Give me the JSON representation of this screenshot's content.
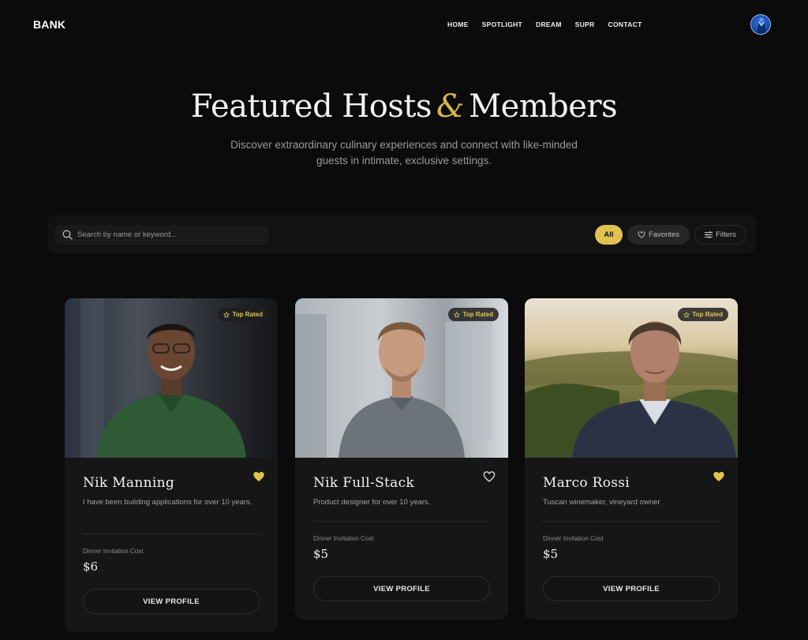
{
  "nav": {
    "logo_mark": "",
    "logo": "BANK",
    "items": [
      "HOME",
      "SPOTLIGHT",
      "DREAM",
      "SUPR",
      "CONTACT"
    ],
    "avatar_icon": "user-avatar"
  },
  "hero": {
    "title_part1": "Featured Hosts",
    "ampersand": "&",
    "title_part2": "Members",
    "subtitle": "Discover extraordinary culinary experiences and connect with like-minded guests in intimate, exclusive settings."
  },
  "toolbar": {
    "search_placeholder": "Search by name or keyword...",
    "search_value": "",
    "filters": {
      "all": "All",
      "favorites": "Favorites",
      "filters": "Filters"
    },
    "active_filter": "All"
  },
  "cards": [
    {
      "name": "Nik Manning",
      "badge": "Top Rated",
      "description": "I have been building applications for over 10 years.",
      "cost_label": "Dinner Invitation Cost",
      "price": "$6",
      "button": "VIEW PROFILE",
      "favorited": true
    },
    {
      "name": "Nik Full-Stack",
      "badge": "Top Rated",
      "description": "Product designer for over 10 years.",
      "cost_label": "Dinner Invitation Cost",
      "price": "$5",
      "button": "VIEW PROFILE",
      "favorited": false
    },
    {
      "name": "Marco Rossi",
      "badge": "Top Rated",
      "description": "Tuscan winemaker, vineyard owner",
      "cost_label": "Dinner Invitation Cost",
      "price": "$5",
      "button": "VIEW PROFILE",
      "favorited": true
    }
  ],
  "colors": {
    "accent": "#e2c24f",
    "background": "#0b0b0b",
    "card": "#161616"
  }
}
